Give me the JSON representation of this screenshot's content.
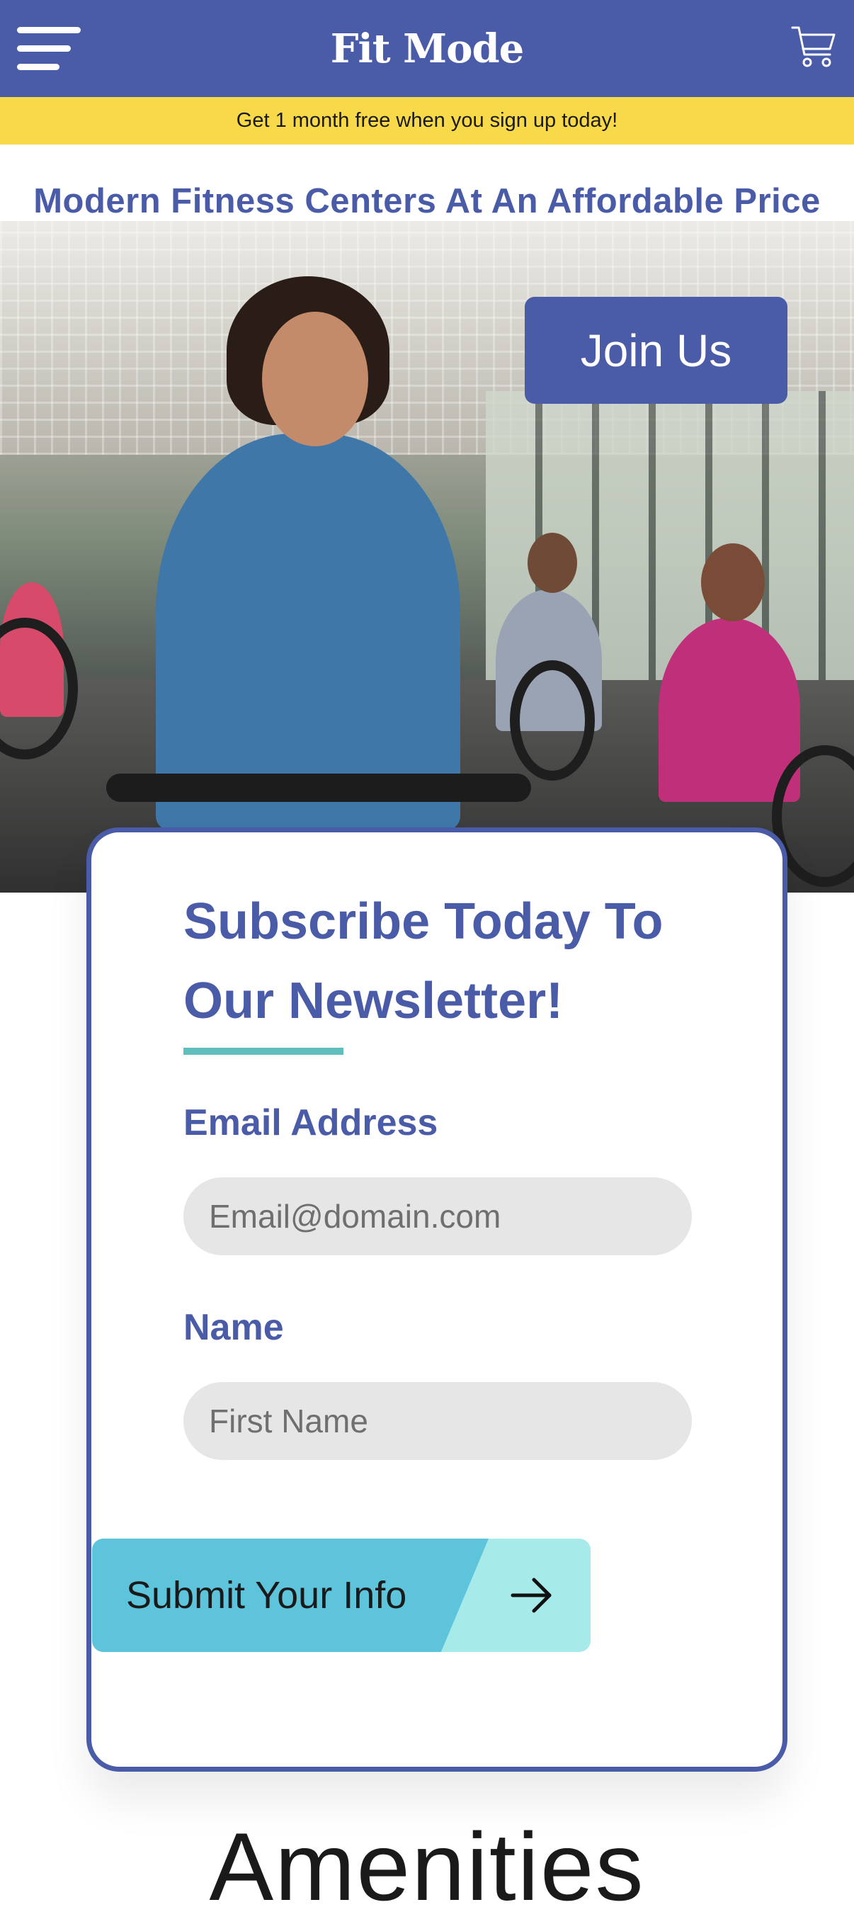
{
  "header": {
    "brand": "Fit Mode",
    "menu_icon": "hamburger-menu-icon",
    "cart_icon": "shopping-cart-icon",
    "background_color": "#4a5ba8"
  },
  "promo": {
    "text": "Get 1 month free when you sign up today!",
    "background_color": "#f8d94a"
  },
  "hero": {
    "tagline": "Modern Fitness Centers At An Affordable Price",
    "join_button": "Join Us"
  },
  "newsletter": {
    "title": "Subscribe Today To Our Newsletter!",
    "email_label": "Email Address",
    "email_placeholder": "Email@domain.com",
    "email_value": "",
    "name_label": "Name",
    "name_placeholder": "First Name",
    "name_value": "",
    "submit_label": "Submit Your Info",
    "submit_icon": "arrow-right-icon",
    "accent_color": "#5fbfbd"
  },
  "amenities": {
    "heading": "Amenities"
  }
}
